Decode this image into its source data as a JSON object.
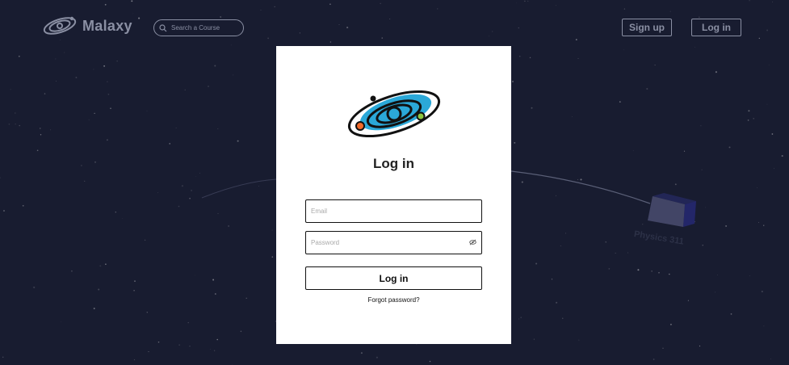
{
  "app": {
    "name": "Malaxy"
  },
  "header": {
    "logo_text": "Malaxy",
    "search_placeholder": "Search a Course",
    "signup_label": "Sign up",
    "login_label": "Log in"
  },
  "background": {
    "course_node_label": "Physics 311"
  },
  "login_modal": {
    "title": "Log in",
    "email_placeholder": "Email",
    "password_placeholder": "Password",
    "submit_label": "Log in",
    "forgot_password_label": "Forgot password?"
  },
  "colors": {
    "background": "#1b1f33",
    "muted_ui": "#8a8fa3",
    "logo_blue": "#2ba8d8",
    "planet_orange": "#f26a2a",
    "planet_green": "#8dc63f",
    "course_cube": "#5b5f86"
  },
  "icons": {
    "logo": "galaxy-icon",
    "search": "search-icon",
    "password_toggle": "eye-off-icon"
  }
}
